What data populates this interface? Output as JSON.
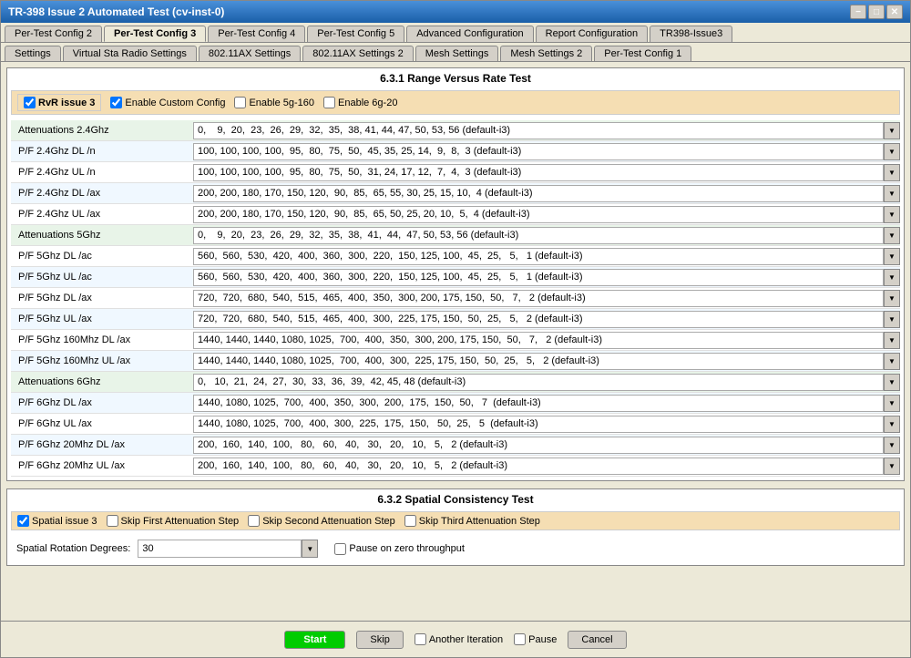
{
  "window": {
    "title": "TR-398 Issue 2 Automated Test  (cv-inst-0)"
  },
  "titlebar": {
    "minimize": "−",
    "maximize": "□",
    "close": "✕"
  },
  "tabs_row1": [
    {
      "label": "Per-Test Config 2",
      "active": false
    },
    {
      "label": "Per-Test Config 3",
      "active": true
    },
    {
      "label": "Per-Test Config 4",
      "active": false
    },
    {
      "label": "Per-Test Config 5",
      "active": false
    },
    {
      "label": "Advanced Configuration",
      "active": false
    },
    {
      "label": "Report Configuration",
      "active": false
    },
    {
      "label": "TR398-Issue3",
      "active": false
    }
  ],
  "tabs_row2": [
    {
      "label": "Settings",
      "active": false
    },
    {
      "label": "Virtual Sta Radio Settings",
      "active": false
    },
    {
      "label": "802.11AX Settings",
      "active": false
    },
    {
      "label": "802.11AX Settings 2",
      "active": false
    },
    {
      "label": "Mesh Settings",
      "active": false
    },
    {
      "label": "Mesh Settings 2",
      "active": false
    },
    {
      "label": "Per-Test Config 1",
      "active": false
    }
  ],
  "section1": {
    "title": "6.3.1 Range Versus Rate Test",
    "rvr_checkbox": "RvR issue 3",
    "rvr_checked": true,
    "enable_custom_config": "Enable Custom Config",
    "enable_custom_checked": true,
    "enable_5g_160": "Enable 5g-160",
    "enable_5g_160_checked": false,
    "enable_6g_20": "Enable 6g-20",
    "enable_6g_20_checked": false,
    "rows": [
      {
        "label": "Attenuations 2.4Ghz",
        "value": "0,    9,  20,  23,  26,  29,  32,  35,  38, 41, 44, 47, 50, 53, 56 (default-i3)",
        "is_attenuation": true
      },
      {
        "label": "P/F 2.4Ghz DL /n",
        "value": "100, 100, 100, 100,  95,  80,  75,  50,  45, 35, 25, 14,  9,  8,  3 (default-i3)",
        "is_attenuation": false
      },
      {
        "label": "P/F 2.4Ghz UL /n",
        "value": "100, 100, 100, 100,  95,  80,  75,  50,  31, 24, 17, 12,  7,  4,  3 (default-i3)",
        "is_attenuation": false
      },
      {
        "label": "P/F 2.4Ghz DL /ax",
        "value": "200, 200, 180, 170, 150, 120,  90,  85,  65, 55, 30, 25, 15, 10,  4 (default-i3)",
        "is_attenuation": false
      },
      {
        "label": "P/F 2.4Ghz UL /ax",
        "value": "200, 200, 180, 170, 150, 120,  90,  85,  65, 50, 25, 20, 10,  5,  4 (default-i3)",
        "is_attenuation": false
      },
      {
        "label": "Attenuations 5Ghz",
        "value": "0,    9,  20,  23,  26,  29,  32,  35,  38,  41,  44,  47, 50, 53, 56 (default-i3)",
        "is_attenuation": true
      },
      {
        "label": "P/F 5Ghz DL /ac",
        "value": "560,  560,  530,  420,  400,  360,  300,  220,  150, 125, 100,  45,  25,   5,   1 (default-i3)",
        "is_attenuation": false
      },
      {
        "label": "P/F 5Ghz UL /ac",
        "value": "560,  560,  530,  420,  400,  360,  300,  220,  150, 125, 100,  45,  25,   5,   1 (default-i3)",
        "is_attenuation": false
      },
      {
        "label": "P/F 5Ghz DL /ax",
        "value": "720,  720,  680,  540,  515,  465,  400,  350,  300, 200, 175, 150,  50,   7,   2 (default-i3)",
        "is_attenuation": false
      },
      {
        "label": "P/F 5Ghz UL /ax",
        "value": "720,  720,  680,  540,  515,  465,  400,  300,  225, 175, 150,  50,  25,   5,   2 (default-i3)",
        "is_attenuation": false
      },
      {
        "label": "P/F 5Ghz 160Mhz DL /ax",
        "value": "1440, 1440, 1440, 1080, 1025,  700,  400,  350,  300, 200, 175, 150,  50,   7,   2 (default-i3)",
        "is_attenuation": false
      },
      {
        "label": "P/F 5Ghz 160Mhz UL /ax",
        "value": "1440, 1440, 1440, 1080, 1025,  700,  400,  300,  225, 175, 150,  50,  25,   5,   2 (default-i3)",
        "is_attenuation": false
      },
      {
        "label": "Attenuations 6Ghz",
        "value": "0,   10,  21,  24,  27,  30,  33,  36,  39,  42, 45, 48 (default-i3)",
        "is_attenuation": true
      },
      {
        "label": "P/F 6Ghz DL /ax",
        "value": "1440, 1080, 1025,  700,  400,  350,  300,  200,  175,  150,  50,   7  (default-i3)",
        "is_attenuation": false
      },
      {
        "label": "P/F 6Ghz UL /ax",
        "value": "1440, 1080, 1025,  700,  400,  300,  225,  175,  150,   50,  25,   5  (default-i3)",
        "is_attenuation": false
      },
      {
        "label": "P/F 6Ghz 20Mhz DL /ax",
        "value": "200,  160,  140,  100,   80,   60,   40,   30,   20,   10,   5,   2 (default-i3)",
        "is_attenuation": false
      },
      {
        "label": "P/F 6Ghz 20Mhz UL /ax",
        "value": "200,  160,  140,  100,   80,   60,   40,   30,   20,   10,   5,   2 (default-i3)",
        "is_attenuation": false
      }
    ]
  },
  "section2": {
    "title": "6.3.2 Spatial Consistency Test",
    "spatial_checkbox": "Spatial issue 3",
    "spatial_checked": true,
    "skip_first": "Skip First Attenuation Step",
    "skip_second": "Skip Second Attenuation Step",
    "skip_third": "Skip Third Attenuation Step",
    "rotation_label": "Spatial Rotation Degrees:",
    "rotation_value": "30",
    "pause_zero": "Pause on zero throughput"
  },
  "bottom_bar": {
    "start": "Start",
    "skip": "Skip",
    "another_iteration": "Another Iteration",
    "pause": "Pause",
    "cancel": "Cancel"
  }
}
